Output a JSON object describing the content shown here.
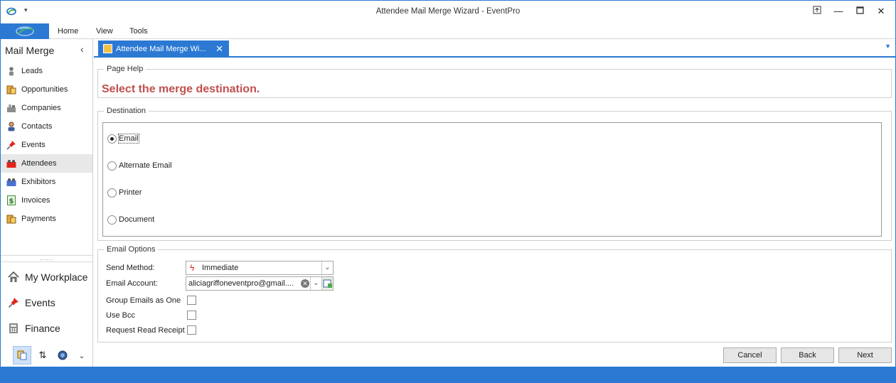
{
  "window": {
    "title": "Attendee Mail Merge Wizard - EventPro",
    "controls": [
      "restore-ribbon",
      "minimize",
      "maximize",
      "close"
    ]
  },
  "ribbon": {
    "tabs": [
      "Home",
      "View",
      "Tools"
    ]
  },
  "nav": {
    "header": "Mail Merge",
    "items": [
      {
        "label": "Leads",
        "icon": "person-icon"
      },
      {
        "label": "Opportunities",
        "icon": "opportunities-icon"
      },
      {
        "label": "Companies",
        "icon": "companies-icon"
      },
      {
        "label": "Contacts",
        "icon": "contact-icon"
      },
      {
        "label": "Events",
        "icon": "pushpin-icon"
      },
      {
        "label": "Attendees",
        "icon": "attendees-icon",
        "selected": true
      },
      {
        "label": "Exhibitors",
        "icon": "exhibitors-icon"
      },
      {
        "label": "Invoices",
        "icon": "invoice-icon"
      },
      {
        "label": "Payments",
        "icon": "payments-icon"
      }
    ],
    "splitter": "......",
    "big_items": [
      {
        "label": "My Workplace",
        "icon": "house-icon"
      },
      {
        "label": "Events",
        "icon": "pushpin-icon"
      },
      {
        "label": "Finance",
        "icon": "calculator-icon"
      }
    ]
  },
  "doc_tab": {
    "label": "Attendee Mail Merge Wi...",
    "close": "✕"
  },
  "page_help": {
    "legend": "Page Help",
    "text": "Select the merge destination."
  },
  "destination": {
    "legend": "Destination",
    "options": [
      {
        "label": "Email",
        "checked": true
      },
      {
        "label": "Alternate Email",
        "checked": false
      },
      {
        "label": "Printer",
        "checked": false
      },
      {
        "label": "Document",
        "checked": false
      }
    ]
  },
  "email_options": {
    "legend": "Email Options",
    "send_method_label": "Send Method:",
    "send_method_value": "Immediate",
    "email_account_label": "Email Account:",
    "email_account_value": "aliciagriffoneventpro@gmail....",
    "group_emails_label": "Group Emails as One",
    "use_bcc_label": "Use Bcc",
    "read_receipt_label": "Request Read Receipt",
    "group_emails_checked": false,
    "use_bcc_checked": false,
    "read_receipt_checked": false
  },
  "buttons": {
    "cancel": "Cancel",
    "back": "Back",
    "next": "Next"
  },
  "colors": {
    "accent": "#2b79d3",
    "help_text": "#c0504d"
  }
}
